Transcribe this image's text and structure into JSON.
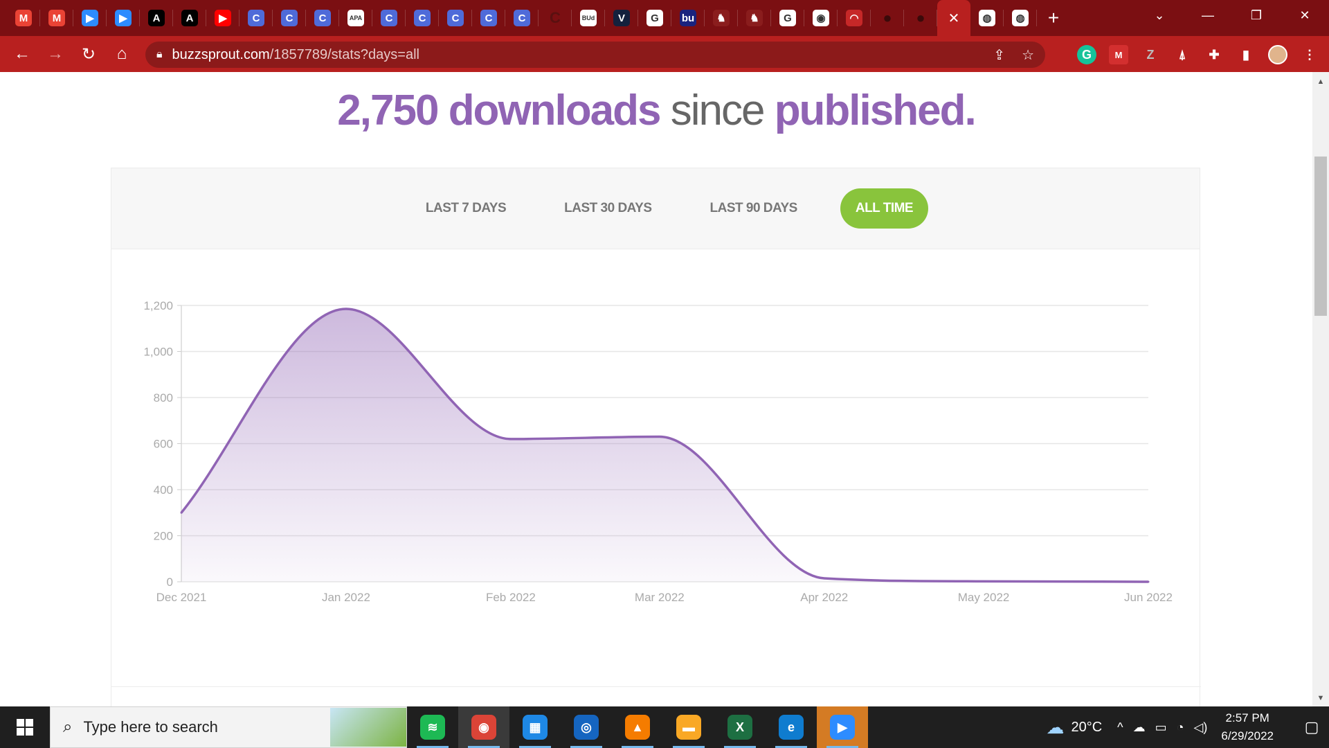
{
  "browser": {
    "tabs": [
      {
        "icon": "gmail-icon",
        "glyph": "M",
        "color": "#ea4335"
      },
      {
        "icon": "gmail-icon",
        "glyph": "M",
        "color": "#ea4335"
      },
      {
        "icon": "zoom-icon",
        "glyph": "▶",
        "color": "#2d8cff"
      },
      {
        "icon": "zoom-icon",
        "glyph": "▶",
        "color": "#2d8cff"
      },
      {
        "icon": "font-a-icon",
        "glyph": "A",
        "color": "#000000"
      },
      {
        "icon": "font-a-icon",
        "glyph": "A",
        "color": "#000000"
      },
      {
        "icon": "youtube-icon",
        "glyph": "▶",
        "color": "#ff0000"
      },
      {
        "icon": "c-circle-icon",
        "glyph": "C",
        "color": "#4f6bd9"
      },
      {
        "icon": "c-circle-icon",
        "glyph": "C",
        "color": "#4f6bd9"
      },
      {
        "icon": "c-circle-icon",
        "glyph": "C",
        "color": "#4f6bd9"
      },
      {
        "icon": "apa-icon",
        "glyph": "APA",
        "color": "#ffffff"
      },
      {
        "icon": "c-circle-icon",
        "glyph": "C",
        "color": "#4f6bd9"
      },
      {
        "icon": "c-circle-icon",
        "glyph": "C",
        "color": "#4f6bd9"
      },
      {
        "icon": "c-circle-icon",
        "glyph": "C",
        "color": "#4f6bd9"
      },
      {
        "icon": "c-circle-icon",
        "glyph": "C",
        "color": "#4f6bd9"
      },
      {
        "icon": "c-circle-icon",
        "glyph": "C",
        "color": "#4f6bd9"
      },
      {
        "icon": "dark-c-icon",
        "glyph": "C",
        "color": "#5a1010"
      },
      {
        "icon": "bud-icon",
        "glyph": "BUd",
        "color": "#ffffff"
      },
      {
        "icon": "v-icon",
        "glyph": "V",
        "color": "#14213d"
      },
      {
        "icon": "google-icon",
        "glyph": "G",
        "color": "#ffffff"
      },
      {
        "icon": "bu-icon",
        "glyph": "bu",
        "color": "#1a237e"
      },
      {
        "icon": "spartan-icon",
        "glyph": "♞",
        "color": "#8a1d1d"
      },
      {
        "icon": "spartan-icon",
        "glyph": "♞",
        "color": "#8a1d1d"
      },
      {
        "icon": "google-icon",
        "glyph": "G",
        "color": "#ffffff"
      },
      {
        "icon": "chrome-icon",
        "glyph": "◉",
        "color": "#ffffff"
      },
      {
        "icon": "speed-icon",
        "glyph": "◠",
        "color": "#c62828"
      },
      {
        "icon": "github-icon",
        "glyph": "●",
        "color": "#3a0a0a"
      },
      {
        "icon": "github-icon",
        "glyph": "●",
        "color": "#3a0a0a"
      }
    ],
    "active_tab_close": "✕",
    "tabs_after": [
      {
        "icon": "globe-icon",
        "glyph": "◍",
        "color": "#ffffff"
      },
      {
        "icon": "globe-icon",
        "glyph": "◍",
        "color": "#ffffff"
      }
    ],
    "new_tab": "+",
    "url_host": "buzzsprout.com",
    "url_path": "/1857789/stats?days=all",
    "theme_colors": {
      "tabstrip": "#7b0f12",
      "toolbar": "#b8201f",
      "omnibox": "#8c1a1a"
    }
  },
  "page": {
    "headline": {
      "count": "2,750",
      "downloads": "downloads",
      "since": "since",
      "published": "published."
    },
    "ranges": [
      {
        "label": "LAST 7 DAYS",
        "active": false
      },
      {
        "label": "LAST 30 DAYS",
        "active": false
      },
      {
        "label": "LAST 90 DAYS",
        "active": false
      },
      {
        "label": "ALL TIME",
        "active": true
      }
    ],
    "accent_color": "#9064b4",
    "active_range_color": "#89c43c"
  },
  "chart_data": {
    "type": "area",
    "x": [
      "2021-12-01",
      "2022-01-01",
      "2022-02-01",
      "2022-03-01",
      "2022-04-01",
      "2022-05-01",
      "2022-06-01"
    ],
    "y": [
      300,
      1185,
      620,
      630,
      15,
      2,
      0
    ],
    "x_tick_labels": [
      "Dec 2021",
      "Jan 2022",
      "Feb 2022",
      "Mar 2022",
      "Apr 2022",
      "May 2022",
      "Jun 2022"
    ],
    "y_tick_labels": [
      "0",
      "200",
      "400",
      "600",
      "800",
      "1,000",
      "1,200"
    ],
    "ylim": [
      0,
      1200
    ],
    "grid": true,
    "series_color": "#9064b4"
  },
  "taskbar": {
    "search_placeholder": "Type here to search",
    "apps": [
      {
        "icon": "spotify-icon",
        "glyph": "≋",
        "color": "#1db954",
        "running": true,
        "active": false
      },
      {
        "icon": "chrome-icon",
        "glyph": "◉",
        "color": "#db4437",
        "running": true,
        "active": true
      },
      {
        "icon": "calendar-icon",
        "glyph": "▦",
        "color": "#1e88e5",
        "running": true,
        "active": false
      },
      {
        "icon": "webcam-icon",
        "glyph": "◎",
        "color": "#1565c0",
        "running": true,
        "active": false
      },
      {
        "icon": "vlc-icon",
        "glyph": "▲",
        "color": "#f57c00",
        "running": true,
        "active": false
      },
      {
        "icon": "file-explorer-icon",
        "glyph": "▬",
        "color": "#f9a825",
        "running": true,
        "active": false
      },
      {
        "icon": "excel-icon",
        "glyph": "X",
        "color": "#1d6f42",
        "running": true,
        "active": false
      },
      {
        "icon": "edge-icon",
        "glyph": "e",
        "color": "#0f7ccf",
        "running": true,
        "active": false
      },
      {
        "icon": "zoom-icon",
        "glyph": "▶",
        "color": "#2d8cff",
        "running": true,
        "active": false,
        "highlight": true
      }
    ],
    "temperature": "20°C",
    "time": "2:57 PM",
    "date": "6/29/2022"
  }
}
